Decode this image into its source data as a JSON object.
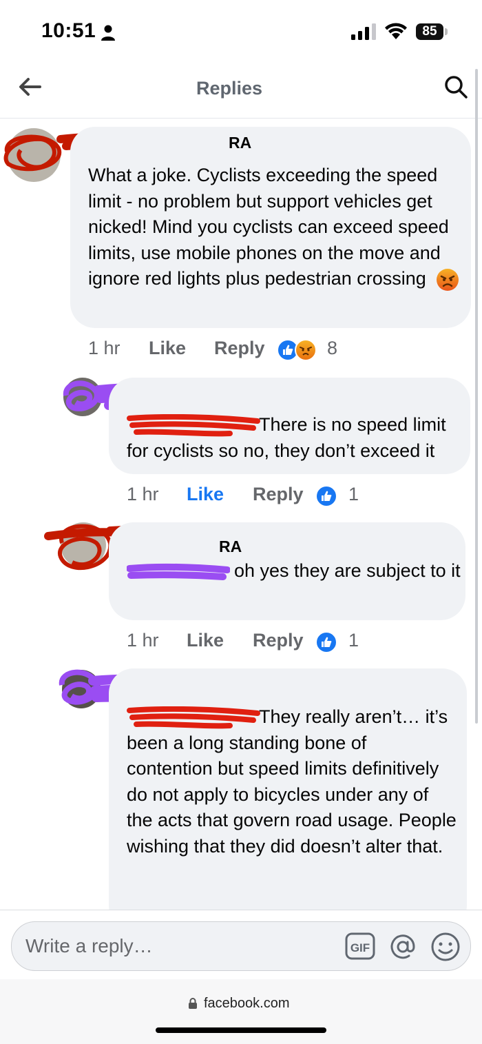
{
  "status_bar": {
    "time": "10:51",
    "battery": "85"
  },
  "header": {
    "title": "Replies"
  },
  "comments": [
    {
      "author_visible": "RA",
      "text": "What a joke. Cyclists exceeding the speed limit - no problem but support vehicles get nicked! Mind you cyclists can exceed speed limits, use mobile phones on the move and ignore red lights plus pedestrian crossing",
      "time": "1 hr",
      "like_label": "Like",
      "reply_label": "Reply",
      "reaction_count": "8"
    },
    {
      "text": "There is no speed limit for cyclists so no, they don’t exceed it",
      "time": "1 hr",
      "like_label": "Like",
      "reply_label": "Reply",
      "reaction_count": "1"
    },
    {
      "author_visible": "RA",
      "text": "oh yes they are subject to it",
      "time": "1 hr",
      "like_label": "Like",
      "reply_label": "Reply",
      "reaction_count": "1"
    },
    {
      "text": "They really aren’t… it’s been a long standing bone of contention but speed limits definitively do not apply to bicycles under any of the acts that govern road usage. People wishing that they did doesn’t alter that."
    }
  ],
  "composer": {
    "placeholder": "Write a reply…",
    "gif_label": "GIF"
  },
  "url_bar": {
    "domain": "facebook.com"
  },
  "colors": {
    "accent": "#1877f2",
    "bubble": "#f0f2f5",
    "meta": "#65676b",
    "red_scribble": "#c41a00",
    "purple_scribble": "#9a4df2"
  }
}
